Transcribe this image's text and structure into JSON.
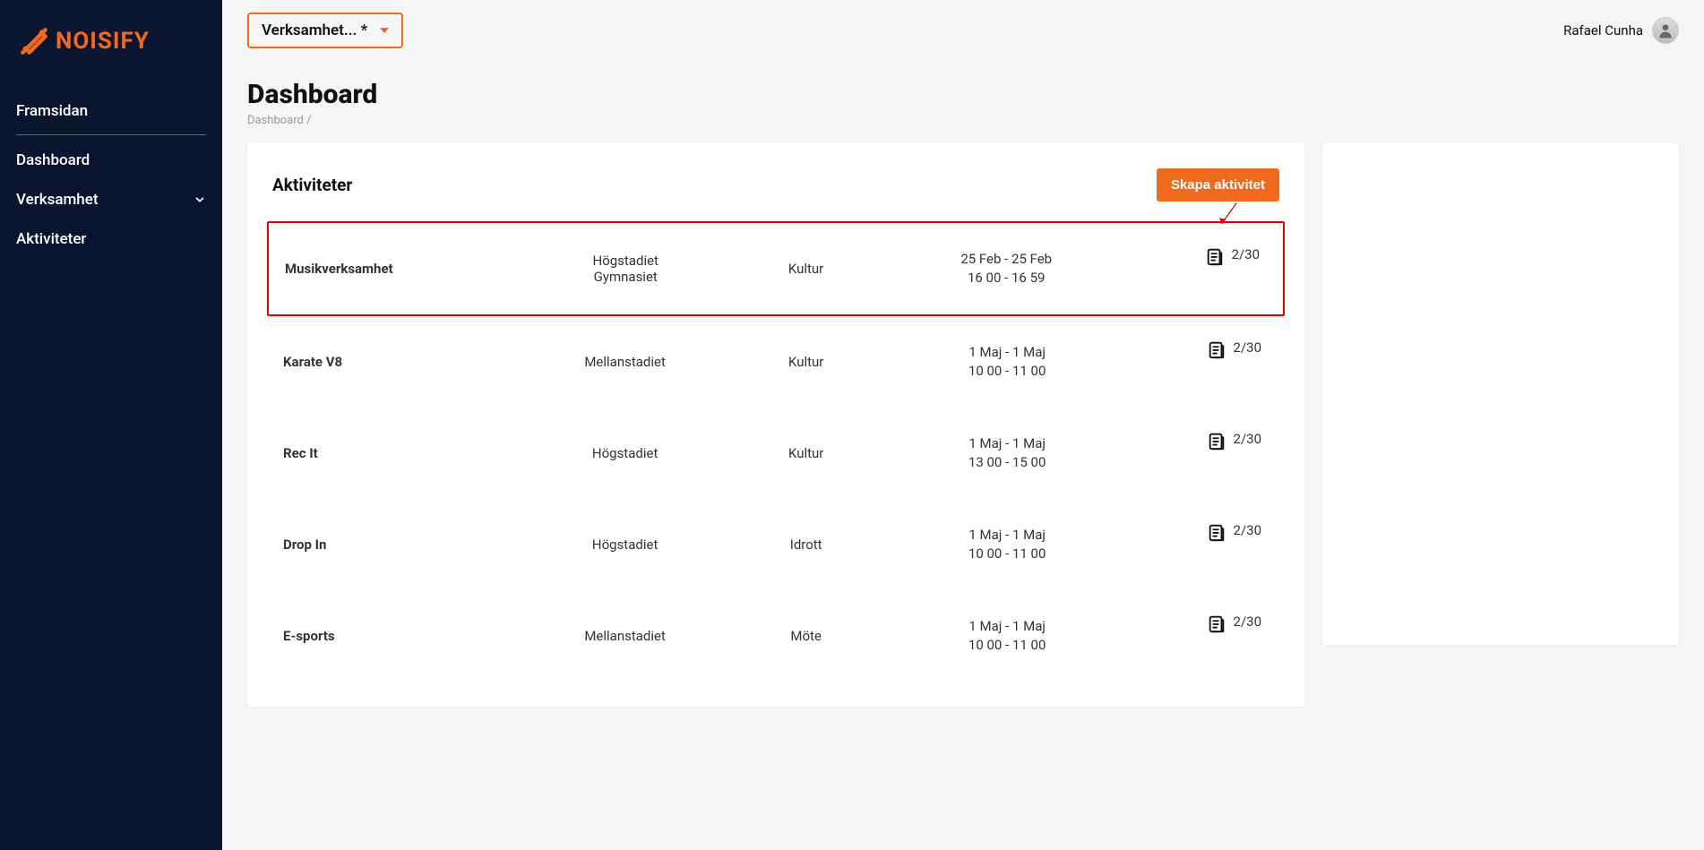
{
  "brand": {
    "name": "NOISIFY"
  },
  "sidebar": {
    "items": [
      {
        "label": "Framsidan"
      },
      {
        "label": "Dashboard"
      },
      {
        "label": "Verksamhet",
        "expandable": true
      },
      {
        "label": "Aktiviteter"
      }
    ]
  },
  "topbar": {
    "selector_label": "Verksamhet... *",
    "user_name": "Rafael Cunha"
  },
  "page": {
    "title": "Dashboard",
    "breadcrumb": "Dashboard /"
  },
  "activities": {
    "heading": "Aktiviteter",
    "create_label": "Skapa aktivitet",
    "rows": [
      {
        "name": "Musikverksamhet",
        "audience_line1": "Högstadiet",
        "audience_line2": "Gymnasiet",
        "category": "Kultur",
        "date": "25 Feb - 25 Feb",
        "time": "16 00 - 16 59",
        "capacity": "2/30",
        "highlight": true
      },
      {
        "name": "Karate V8",
        "audience_line1": "Mellanstadiet",
        "audience_line2": "",
        "category": "Kultur",
        "date": "1 Maj - 1 Maj",
        "time": "10 00 - 11 00",
        "capacity": "2/30",
        "highlight": false
      },
      {
        "name": "Rec It",
        "audience_line1": "Högstadiet",
        "audience_line2": "",
        "category": "Kultur",
        "date": "1 Maj - 1 Maj",
        "time": "13 00 - 15 00",
        "capacity": "2/30",
        "highlight": false
      },
      {
        "name": "Drop In",
        "audience_line1": "Högstadiet",
        "audience_line2": "",
        "category": "Idrott",
        "date": "1 Maj - 1 Maj",
        "time": "10 00 - 11 00",
        "capacity": "2/30",
        "highlight": false
      },
      {
        "name": "E-sports",
        "audience_line1": "Mellanstadiet",
        "audience_line2": "",
        "category": "Möte",
        "date": "1 Maj - 1 Maj",
        "time": "10 00 - 11 00",
        "capacity": "2/30",
        "highlight": false
      }
    ]
  }
}
